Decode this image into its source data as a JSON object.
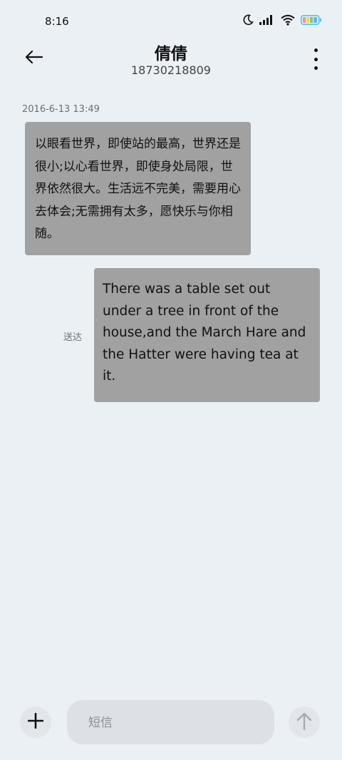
{
  "status_bar": {
    "time": "8:16",
    "icons": [
      "moon-icon",
      "signal-icon",
      "wifi-icon",
      "battery-icon"
    ]
  },
  "header": {
    "contact_name": "倩倩",
    "contact_number": "18730218809",
    "back_icon": "arrow-left-icon",
    "more_icon": "more-vertical-icon"
  },
  "conversation": {
    "timestamp": "2016-6-13 13:49",
    "messages": [
      {
        "direction": "incoming",
        "text": "以眼看世界，即使站的最高，世界还是很小;以心看世界，即使身处局限，世界依然很大。生活远不完美，需要用心去体会;无需拥有太多，愿快乐与你相随。"
      },
      {
        "direction": "outgoing",
        "text": "There was a table set out under a tree in front of the house,and the March Hare and the Hatter were having tea at it.",
        "status": "送达"
      }
    ]
  },
  "composer": {
    "placeholder": "短信",
    "value": "",
    "add_icon": "plus-icon",
    "send_icon": "arrow-up-icon"
  },
  "colors": {
    "background": "#ebf0f5",
    "bubble": "#a1a1a1",
    "battery_accent": "#4fc3f7"
  }
}
